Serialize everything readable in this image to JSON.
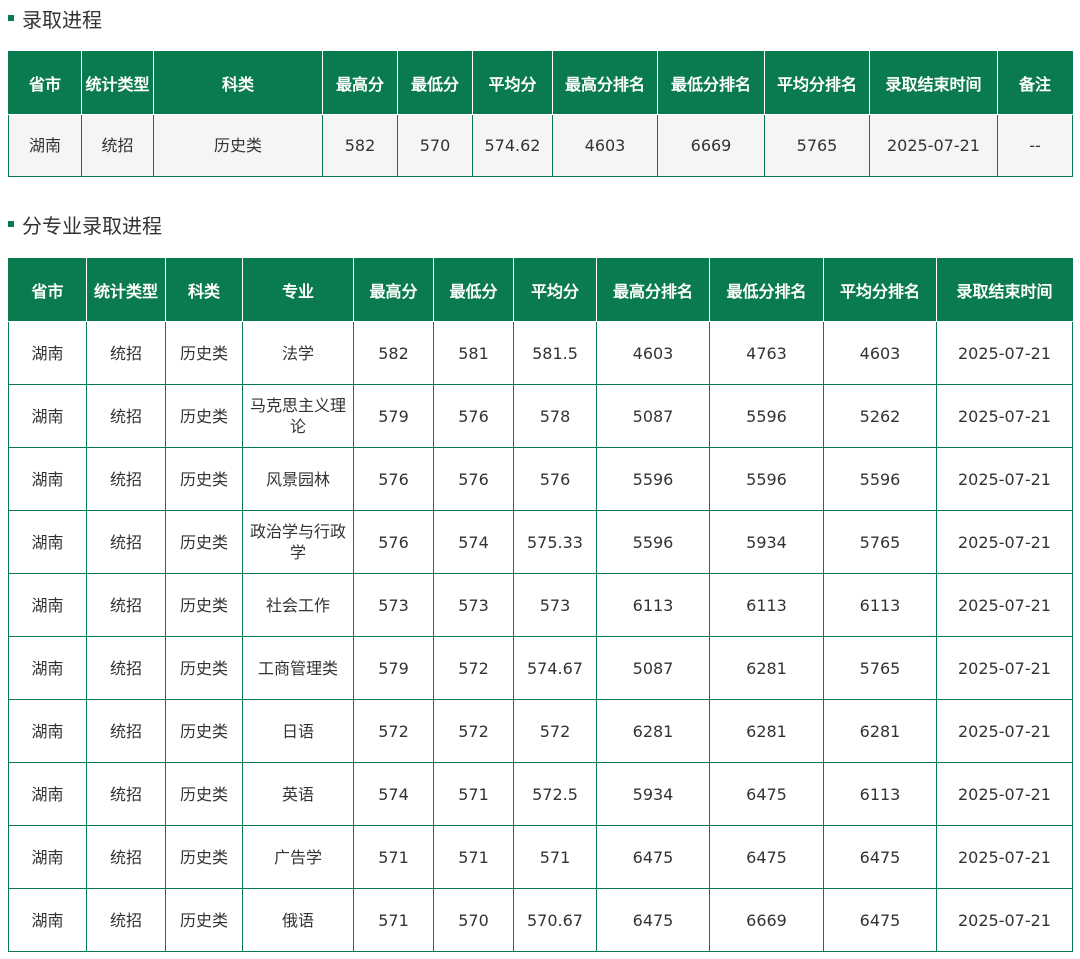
{
  "section1": {
    "title": "录取进程",
    "headers": [
      "省市",
      "统计类型",
      "科类",
      "最高分",
      "最低分",
      "平均分",
      "最高分排名",
      "最低分排名",
      "平均分排名",
      "录取结束时间",
      "备注"
    ],
    "rows": [
      [
        "湖南",
        "统招",
        "历史类",
        "582",
        "570",
        "574.62",
        "4603",
        "6669",
        "5765",
        "2025-07-21",
        "--"
      ]
    ]
  },
  "section2": {
    "title": "分专业录取进程",
    "headers": [
      "省市",
      "统计类型",
      "科类",
      "专业",
      "最高分",
      "最低分",
      "平均分",
      "最高分排名",
      "最低分排名",
      "平均分排名",
      "录取结束时间"
    ],
    "rows": [
      [
        "湖南",
        "统招",
        "历史类",
        "法学",
        "582",
        "581",
        "581.5",
        "4603",
        "4763",
        "4603",
        "2025-07-21"
      ],
      [
        "湖南",
        "统招",
        "历史类",
        "马克思主义理论",
        "579",
        "576",
        "578",
        "5087",
        "5596",
        "5262",
        "2025-07-21"
      ],
      [
        "湖南",
        "统招",
        "历史类",
        "风景园林",
        "576",
        "576",
        "576",
        "5596",
        "5596",
        "5596",
        "2025-07-21"
      ],
      [
        "湖南",
        "统招",
        "历史类",
        "政治学与行政学",
        "576",
        "574",
        "575.33",
        "5596",
        "5934",
        "5765",
        "2025-07-21"
      ],
      [
        "湖南",
        "统招",
        "历史类",
        "社会工作",
        "573",
        "573",
        "573",
        "6113",
        "6113",
        "6113",
        "2025-07-21"
      ],
      [
        "湖南",
        "统招",
        "历史类",
        "工商管理类",
        "579",
        "572",
        "574.67",
        "5087",
        "6281",
        "5765",
        "2025-07-21"
      ],
      [
        "湖南",
        "统招",
        "历史类",
        "日语",
        "572",
        "572",
        "572",
        "6281",
        "6281",
        "6281",
        "2025-07-21"
      ],
      [
        "湖南",
        "统招",
        "历史类",
        "英语",
        "574",
        "571",
        "572.5",
        "5934",
        "6475",
        "6113",
        "2025-07-21"
      ],
      [
        "湖南",
        "统招",
        "历史类",
        "广告学",
        "571",
        "571",
        "571",
        "6475",
        "6475",
        "6475",
        "2025-07-21"
      ],
      [
        "湖南",
        "统招",
        "历史类",
        "俄语",
        "571",
        "570",
        "570.67",
        "6475",
        "6669",
        "6475",
        "2025-07-21"
      ]
    ]
  },
  "colors": {
    "header_bg": "#0a7a4f",
    "header_text": "#ffffff",
    "border": "#0a7a4f",
    "marker": "#0a7a4f"
  }
}
